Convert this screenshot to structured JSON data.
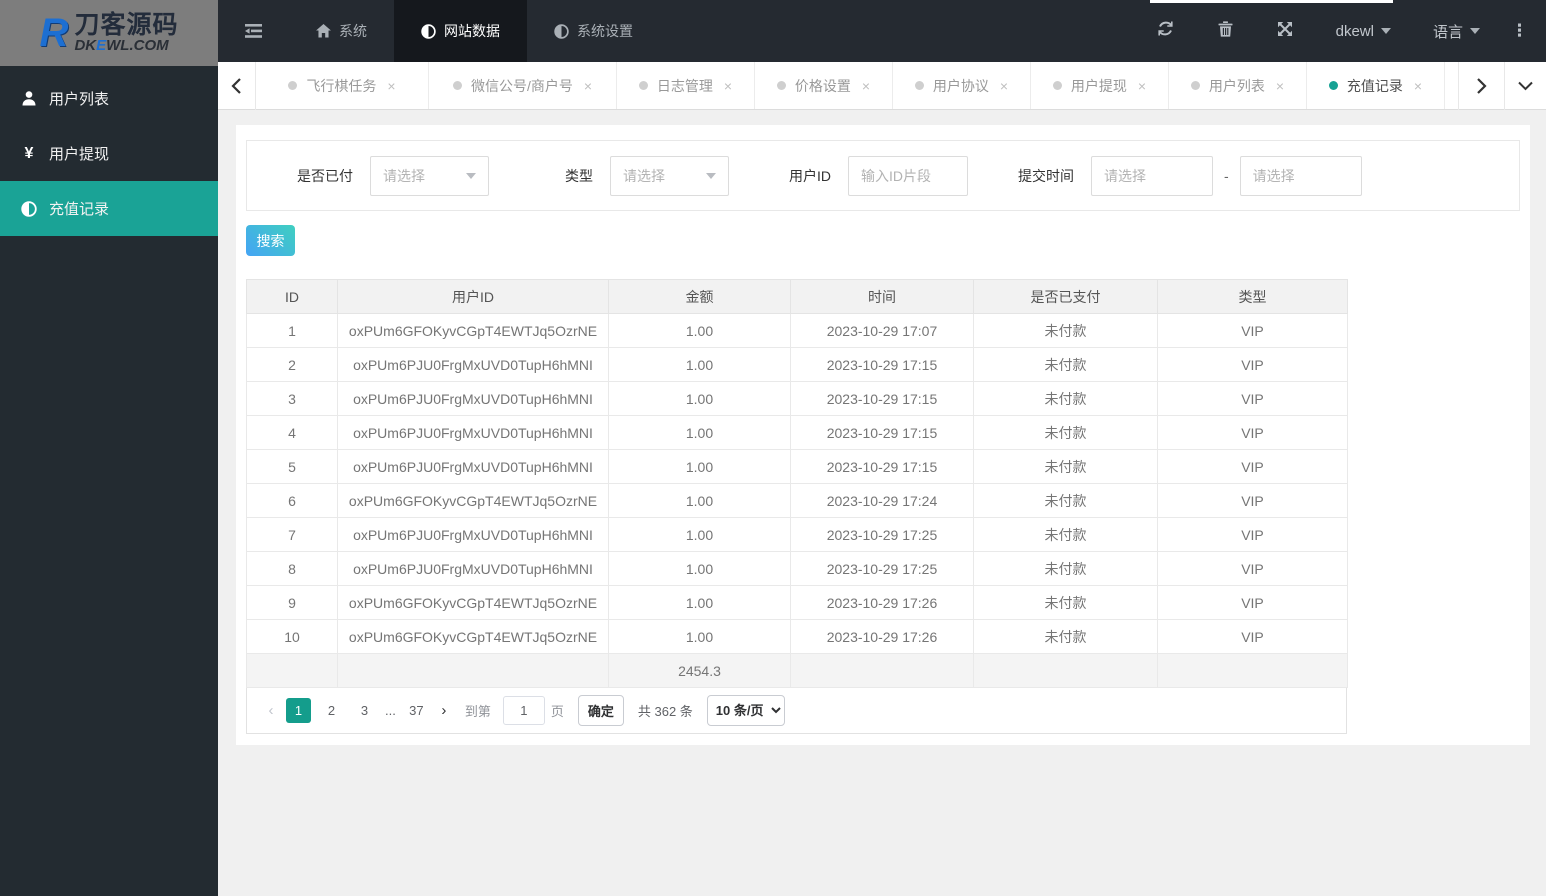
{
  "topbar": {
    "logo": {
      "title": "刀客源码",
      "sub_prefix": "DK",
      "sub_accent": "E",
      "sub_suffix": "WL.COM",
      "mark": "R"
    },
    "menu": [
      {
        "label": "系统",
        "icon": "home-icon"
      },
      {
        "label": "网站数据",
        "icon": "adjust-icon",
        "active": true
      },
      {
        "label": "系统设置",
        "icon": "adjust-icon"
      }
    ],
    "username": "dkewl",
    "language_label": "语言"
  },
  "tabbar": {
    "tabs": [
      {
        "label": "飞行棋任务"
      },
      {
        "label": "微信公号/商户号"
      },
      {
        "label": "日志管理"
      },
      {
        "label": "价格设置"
      },
      {
        "label": "用户协议"
      },
      {
        "label": "用户提现"
      },
      {
        "label": "用户列表"
      },
      {
        "label": "充值记录",
        "active": true
      }
    ],
    "close_glyph": "×"
  },
  "sidebar": {
    "items": [
      {
        "label": "用户列表",
        "icon": "user-icon"
      },
      {
        "label": "用户提现",
        "icon": "yen-icon",
        "glyph": "¥"
      },
      {
        "label": "充值记录",
        "icon": "adjust-icon",
        "active": true
      }
    ]
  },
  "filters": {
    "paid_label": "是否已付",
    "paid_value": "请选择",
    "type_label": "类型",
    "type_value": "请选择",
    "userid_label": "用户ID",
    "userid_placeholder": "输入ID片段",
    "time_label": "提交时间",
    "time_from_placeholder": "请选择",
    "time_to_placeholder": "请选择",
    "separator": "-"
  },
  "search_label": "搜索",
  "table": {
    "columns": [
      "ID",
      "用户ID",
      "金额",
      "时间",
      "是否已支付",
      "类型"
    ],
    "rows": [
      [
        "1",
        "oxPUm6GFOKyvCGpT4EWTJq5OzrNE",
        "1.00",
        "2023-10-29 17:07",
        "未付款",
        "VIP"
      ],
      [
        "2",
        "oxPUm6PJU0FrgMxUVD0TupH6hMNI",
        "1.00",
        "2023-10-29 17:15",
        "未付款",
        "VIP"
      ],
      [
        "3",
        "oxPUm6PJU0FrgMxUVD0TupH6hMNI",
        "1.00",
        "2023-10-29 17:15",
        "未付款",
        "VIP"
      ],
      [
        "4",
        "oxPUm6PJU0FrgMxUVD0TupH6hMNI",
        "1.00",
        "2023-10-29 17:15",
        "未付款",
        "VIP"
      ],
      [
        "5",
        "oxPUm6PJU0FrgMxUVD0TupH6hMNI",
        "1.00",
        "2023-10-29 17:15",
        "未付款",
        "VIP"
      ],
      [
        "6",
        "oxPUm6GFOKyvCGpT4EWTJq5OzrNE",
        "1.00",
        "2023-10-29 17:24",
        "未付款",
        "VIP"
      ],
      [
        "7",
        "oxPUm6PJU0FrgMxUVD0TupH6hMNI",
        "1.00",
        "2023-10-29 17:25",
        "未付款",
        "VIP"
      ],
      [
        "8",
        "oxPUm6PJU0FrgMxUVD0TupH6hMNI",
        "1.00",
        "2023-10-29 17:25",
        "未付款",
        "VIP"
      ],
      [
        "9",
        "oxPUm6GFOKyvCGpT4EWTJq5OzrNE",
        "1.00",
        "2023-10-29 17:26",
        "未付款",
        "VIP"
      ],
      [
        "10",
        "oxPUm6GFOKyvCGpT4EWTJq5OzrNE",
        "1.00",
        "2023-10-29 17:26",
        "未付款",
        "VIP"
      ]
    ],
    "total_amount": "2454.3"
  },
  "pagination": {
    "prev": "‹",
    "next": "›",
    "pages": [
      "1",
      "2",
      "3",
      "...",
      "37"
    ],
    "active_page": "1",
    "goto_label": "到第",
    "goto_value": "1",
    "page_label": "页",
    "confirm_label": "确定",
    "total_text": "共 362 条",
    "page_size": "10 条/页"
  },
  "colors": {
    "accent_teal": "#17a294",
    "navbar_bg": "#252a31",
    "nav_active_bg": "#15181d",
    "sidebar_bg": "#232b31",
    "sidebar_active_bg": "#1aa396",
    "search_gradient_from": "#45a4f5",
    "search_gradient_to": "#3fcfc0",
    "logo_bg": "#7d7d7d"
  }
}
